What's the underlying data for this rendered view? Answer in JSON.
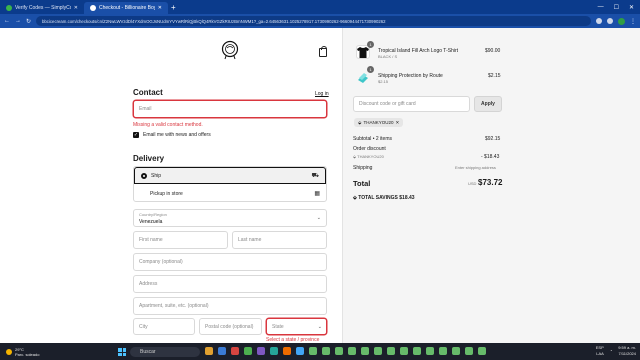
{
  "browser": {
    "tabs": [
      {
        "label": "Verify Codes — SimplyCodes",
        "active": false
      },
      {
        "label": "Checkout - Billionaire Boys Clu",
        "active": true
      }
    ],
    "url": "bbcicecream.com/checkouts/cn/Z2NwLWVzdDl4YXdmOGJsNUdmYVYwRlRiQjBkQlQ4RkVGZkRIUzBmNWM1?_ga=2.64563631.1025278917.1730990262-9660944471730990262"
  },
  "checkout": {
    "contact_heading": "Contact",
    "login_link": "Log in",
    "email_placeholder": "Email",
    "email_error": "Missing a valid contact method.",
    "news_label": "Email me with news and offers",
    "delivery_heading": "Delivery",
    "ship_label": "Ship",
    "pickup_label": "Pickup in store",
    "country_label": "Country/Region",
    "country_value": "Venezuela",
    "first_name": "First name",
    "last_name": "Last name",
    "company": "Company (optional)",
    "address": "Address",
    "apartment": "Apartment, suite, etc. (optional)",
    "city": "City",
    "postal": "Postal code (optional)",
    "state": "State",
    "state_error": "Select a state / province"
  },
  "summary": {
    "items": [
      {
        "qty": "1",
        "name": "Tropical Island Fill Arch Logo T-Shirt",
        "variant": "BLACK / S",
        "price": "$90.00"
      },
      {
        "qty": "1",
        "name": "Shipping Protection by Route",
        "variant": "$2.15",
        "price": "$2.15"
      }
    ],
    "discount_placeholder": "Discount code or gift card",
    "apply_label": "Apply",
    "applied_code": "THANKYOU20",
    "subtotal_label": "Subtotal • 2 items",
    "subtotal_value": "$92.15",
    "order_discount_label": "Order discount",
    "discount_code": "THANKYOU20",
    "discount_value": "- $18.43",
    "shipping_label": "Shipping",
    "shipping_value": "Enter shipping address",
    "total_label": "Total",
    "currency": "USD",
    "total_value": "$73.72",
    "savings_label": "TOTAL SAVINGS",
    "savings_value": "$18.43"
  },
  "taskbar": {
    "temp": "29°C",
    "weather": "Parc. soleado",
    "search": "Buscar",
    "lang": "ESP",
    "lang2": "LAA",
    "time": "9:59 a. m.",
    "date": "7/11/2024"
  }
}
